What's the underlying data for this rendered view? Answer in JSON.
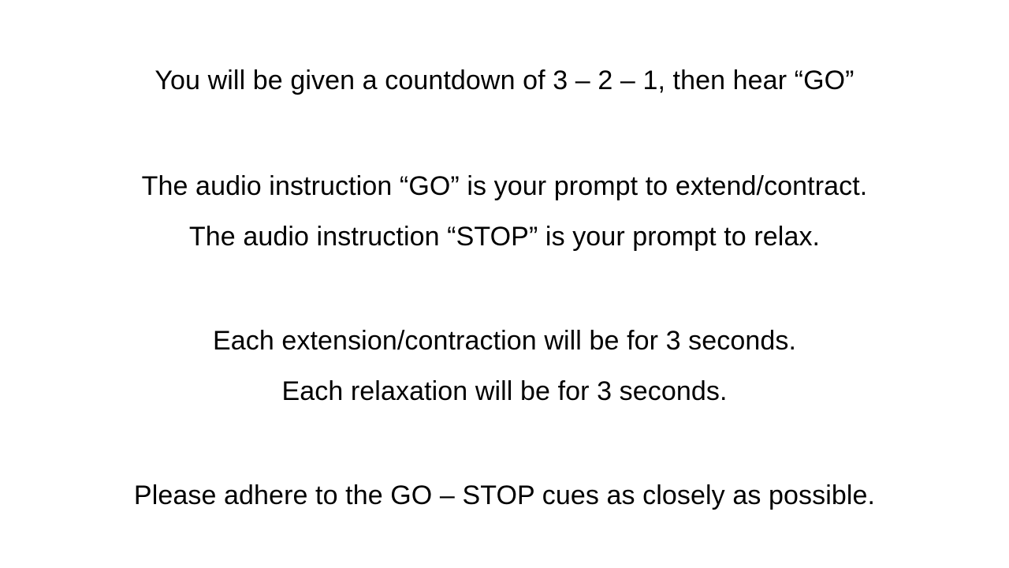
{
  "slide": {
    "lines": [
      "You will be given a countdown of 3 – 2 – 1, then hear “GO”",
      "The audio instruction “GO” is your prompt to extend/contract.",
      "The audio instruction “STOP” is your prompt to relax.",
      "Each extension/contraction will be for 3 seconds.",
      "Each relaxation will be for 3 seconds.",
      "Please adhere to the GO – STOP cues as closely as possible."
    ]
  }
}
